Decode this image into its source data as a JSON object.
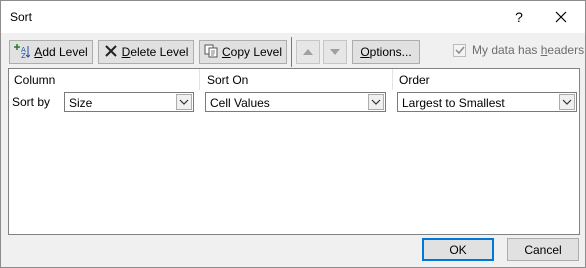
{
  "window": {
    "title": "Sort",
    "help_label": "?",
    "close_icon": "close-icon"
  },
  "toolbar": {
    "add_level": {
      "underline": "A",
      "rest": "dd Level",
      "icon": "add-level-icon"
    },
    "delete_level": {
      "underline": "D",
      "rest": "elete Level",
      "icon": "delete-x-icon"
    },
    "copy_level": {
      "underline": "C",
      "rest": "opy Level",
      "icon": "copy-icon"
    },
    "move_up_icon": "arrow-up-icon",
    "move_down_icon": "arrow-down-icon",
    "options": {
      "underline": "O",
      "rest": "ptions..."
    }
  },
  "headers_checkbox": {
    "label_pre": "My data has ",
    "label_underline": "h",
    "label_post": "eaders",
    "checked": true,
    "enabled": false
  },
  "grid": {
    "columns": [
      "Column",
      "Sort On",
      "Order"
    ],
    "rows": [
      {
        "label": "Sort by",
        "column": "Size",
        "sort_on": "Cell Values",
        "order": "Largest to Smallest"
      }
    ]
  },
  "footer": {
    "ok_label": "OK",
    "cancel_label": "Cancel"
  },
  "colors": {
    "dialog_bg": "#f0f0f0",
    "focus_border": "#0078d7",
    "disabled_text": "#6d6d6d"
  }
}
